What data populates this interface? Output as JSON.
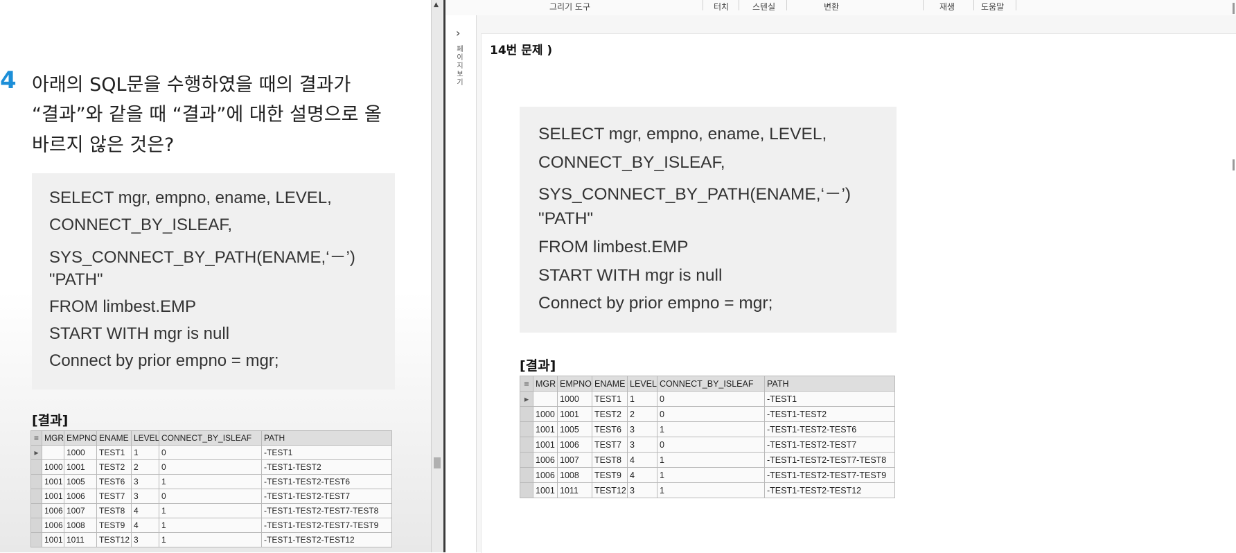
{
  "left": {
    "question_number": "4",
    "question_lines": [
      "아래의 SQL문을 수행하였을 때의 결과가",
      "“결과”와 같을 때 “결과”에 대한 설명으로 올",
      "바르지 않은 것은?"
    ],
    "sql_lines": [
      "SELECT mgr, empno, ename, LEVEL,",
      "CONNECT_BY_ISLEAF,",
      "SYS_CONNECT_BY_PATH(ENAME,‘－’)",
      "\"PATH\"",
      "FROM limbest.EMP",
      "START WITH mgr is null",
      "Connect by prior empno = mgr;"
    ],
    "result_label": "[결과]"
  },
  "right": {
    "toolbar": [
      "그리기 도구",
      "터치",
      "스텐실",
      "변환",
      "재생",
      "도움말"
    ],
    "side_label": "페이지보기",
    "problem_title": "14번 문제 )",
    "sql_lines": [
      "SELECT mgr, empno, ename, LEVEL,",
      "CONNECT_BY_ISLEAF,",
      "SYS_CONNECT_BY_PATH(ENAME,‘－’)",
      "\"PATH\"",
      "FROM limbest.EMP",
      "START WITH mgr is null",
      "Connect by prior empno = mgr;"
    ],
    "result_label": "[결과]"
  },
  "result_table": {
    "columns": [
      "MGR",
      "EMPNO",
      "ENAME",
      "LEVEL",
      "CONNECT_BY_ISLEAF",
      "PATH"
    ],
    "rows": [
      [
        "",
        "1000",
        "TEST1",
        "1",
        "0",
        "-TEST1"
      ],
      [
        "1000",
        "1001",
        "TEST2",
        "2",
        "0",
        "-TEST1-TEST2"
      ],
      [
        "1001",
        "1005",
        "TEST6",
        "3",
        "1",
        "-TEST1-TEST2-TEST6"
      ],
      [
        "1001",
        "1006",
        "TEST7",
        "3",
        "0",
        "-TEST1-TEST2-TEST7"
      ],
      [
        "1006",
        "1007",
        "TEST8",
        "4",
        "1",
        "-TEST1-TEST2-TEST7-TEST8"
      ],
      [
        "1006",
        "1008",
        "TEST9",
        "4",
        "1",
        "-TEST1-TEST2-TEST7-TEST9"
      ],
      [
        "1001",
        "1011",
        "TEST12",
        "3",
        "1",
        "-TEST1-TEST2-TEST12"
      ]
    ],
    "header_icon": "grid-menu-icon",
    "current_row_icon": "row-pointer-icon"
  }
}
